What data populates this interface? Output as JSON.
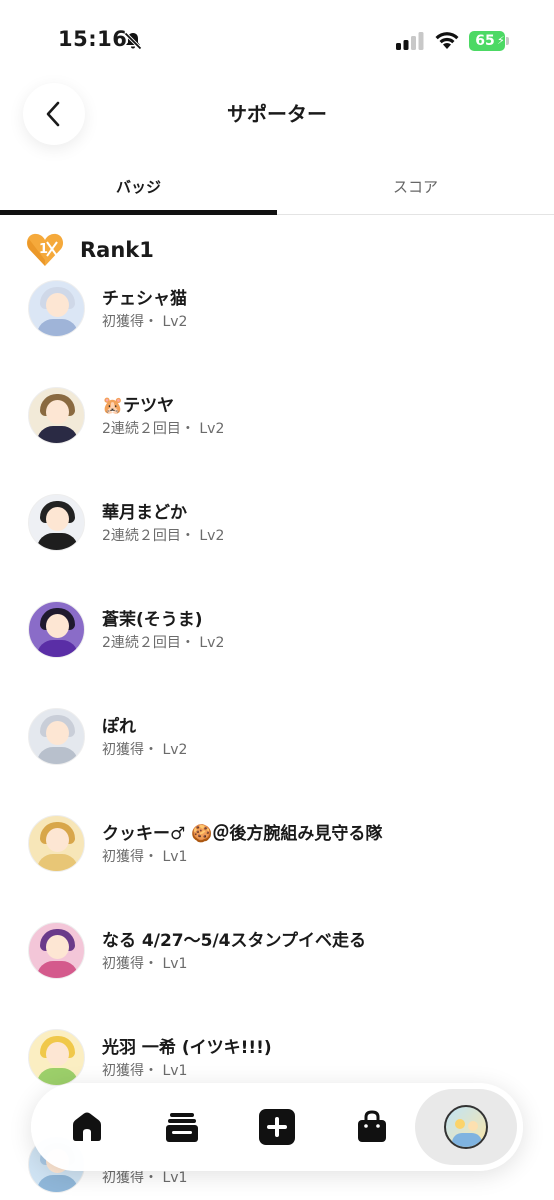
{
  "status_bar": {
    "time": "15:16",
    "battery": "65"
  },
  "header": {
    "title": "サポーター"
  },
  "tabs": [
    {
      "label": "バッジ",
      "active": true
    },
    {
      "label": "スコア",
      "active": false
    }
  ],
  "rank": {
    "label": "Rank1",
    "badge_number": "1"
  },
  "supporters": [
    {
      "name": "チェシャ猫",
      "sub": "初獲得・ Lv2"
    },
    {
      "name": "🐹テツヤ",
      "sub": "2連続２回目・ Lv2"
    },
    {
      "name": "華月まどか",
      "sub": "2連続２回目・ Lv2"
    },
    {
      "name": "蒼茉(そうま)",
      "sub": "2連続２回目・ Lv2"
    },
    {
      "name": "ぽれ",
      "sub": "初獲得・ Lv2"
    },
    {
      "name": "クッキー♂ 🍪＠後方腕組み見守る隊",
      "sub": "初獲得・ Lv1"
    },
    {
      "name": "なる 4/27〜5/4スタンプイベ走る",
      "sub": "初獲得・ Lv1"
    },
    {
      "name": "光羽 一希 (イツキ!!!)",
      "sub": "初獲得・ Lv1"
    },
    {
      "name": "",
      "sub": "初獲得・ Lv1"
    }
  ],
  "colors": {
    "rank_badge": "#f5a93b",
    "battery": "#4cd964",
    "tab_indicator": "#111111"
  },
  "icons": {
    "back": "chevron-left-icon",
    "home": "home-icon",
    "cards": "stack-icon",
    "add": "plus-square-icon",
    "shop": "bag-icon"
  }
}
